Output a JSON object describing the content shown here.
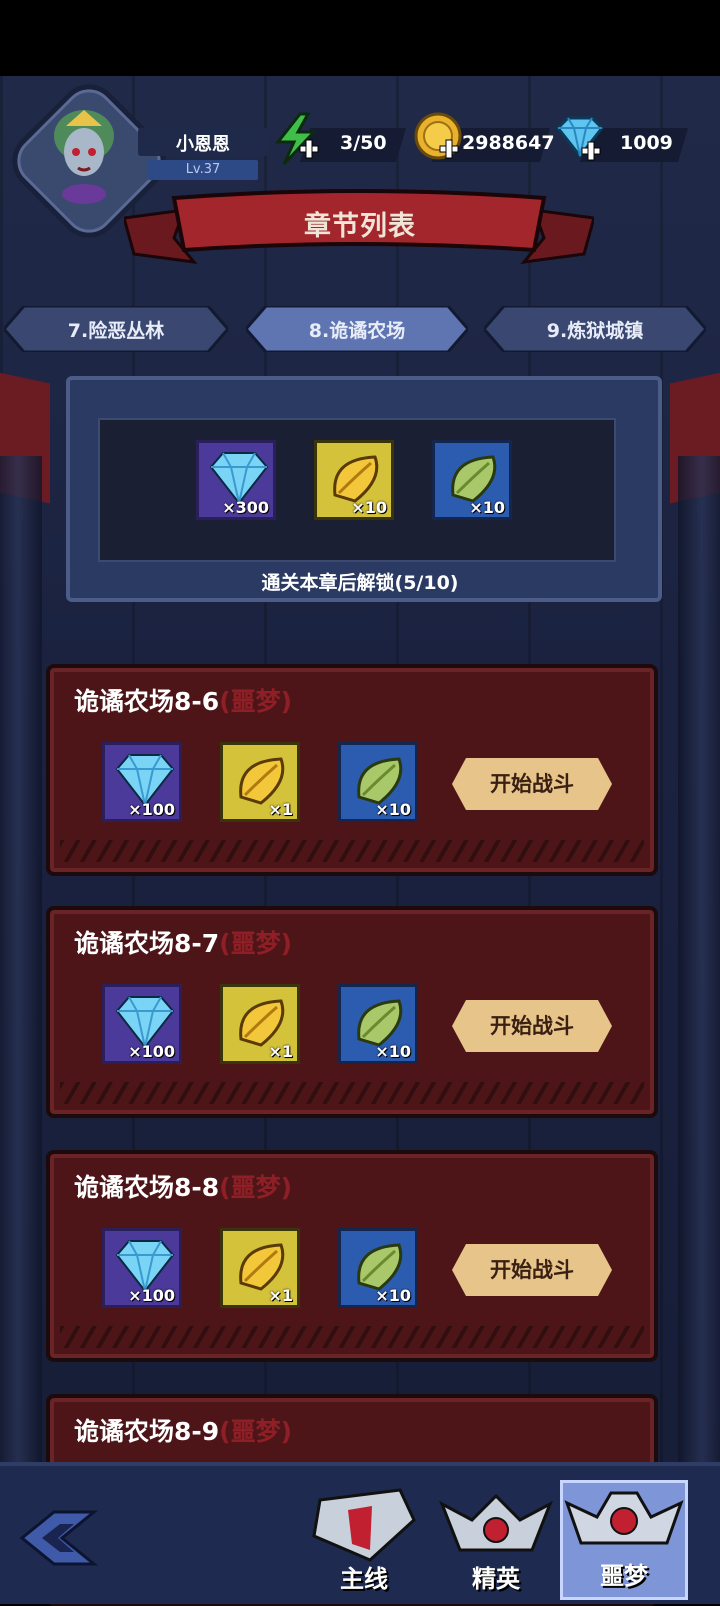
{
  "player": {
    "name": "小恩恩",
    "level": "Lv.37"
  },
  "resources": {
    "energy": "3/50",
    "gold": "2988647",
    "diamonds": "1009"
  },
  "header": {
    "title": "章节列表"
  },
  "chapter_tabs": [
    {
      "label": "7.险恶丛林"
    },
    {
      "label": "8.诡谲农场"
    },
    {
      "label": "9.炼狱城镇"
    }
  ],
  "chapter_reward": {
    "items": [
      {
        "icon": "diamond-icon",
        "qty": "×300"
      },
      {
        "icon": "gold-feather-icon",
        "qty": "×10"
      },
      {
        "icon": "green-leaf-icon",
        "qty": "×10"
      }
    ],
    "unlock_text": "通关本章后解锁(5/10)"
  },
  "stages": [
    {
      "name": "诡谲农场8-6",
      "tag": "(噩梦)",
      "items": [
        "×100",
        "×1",
        "×10"
      ],
      "button": "开始战斗"
    },
    {
      "name": "诡谲农场8-7",
      "tag": "(噩梦)",
      "items": [
        "×100",
        "×1",
        "×10"
      ],
      "button": "开始战斗"
    },
    {
      "name": "诡谲农场8-8",
      "tag": "(噩梦)",
      "items": [
        "×100",
        "×1",
        "×10"
      ],
      "button": "开始战斗"
    },
    {
      "name": "诡谲农场8-9",
      "tag": "(噩梦)",
      "items": [],
      "button": ""
    }
  ],
  "bottom_nav": [
    {
      "label": "主线"
    },
    {
      "label": "精英"
    },
    {
      "label": "噩梦",
      "active": true
    }
  ],
  "colors": {
    "background": "#1a2240",
    "card": "#4d1518",
    "button": "#e6c48a",
    "nightmare_tag": "#8e1f26",
    "active_tab": "#7e96d8"
  }
}
